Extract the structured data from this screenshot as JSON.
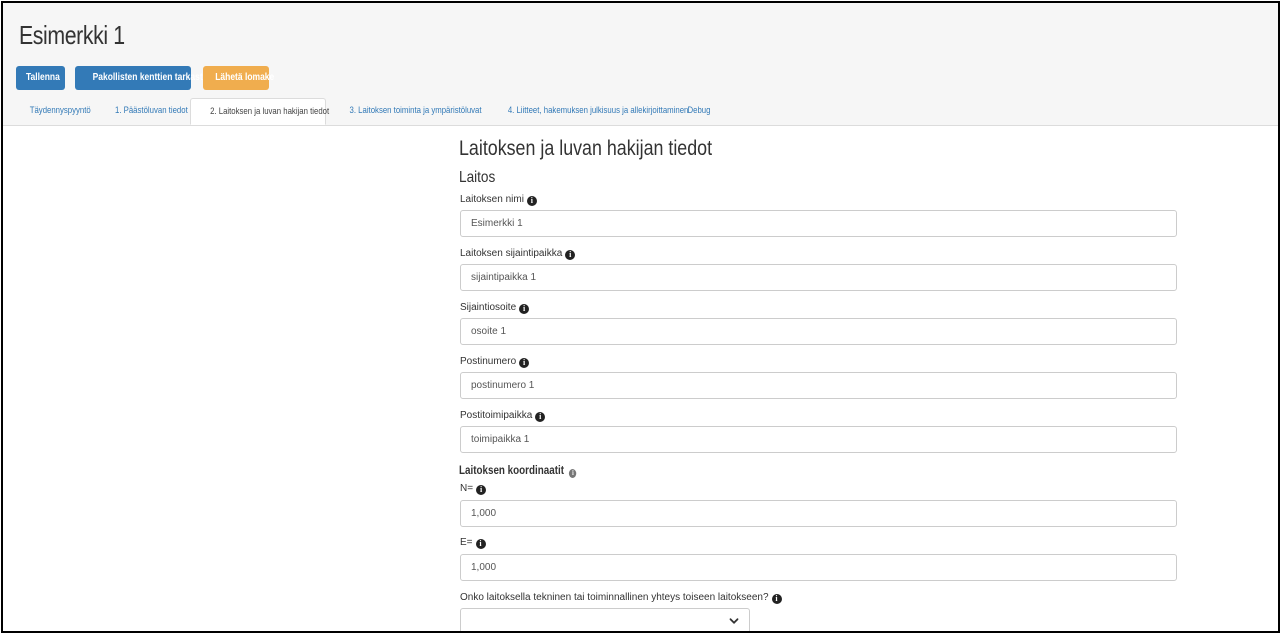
{
  "header": {
    "title": "Esimerkki 1",
    "buttons": {
      "save": "Tallenna",
      "check": "Pakollisten kenttien tarkastus",
      "send": "Lähetä lomake"
    },
    "tabs": [
      {
        "label": "Täydennyspyyntö",
        "active": false
      },
      {
        "label": "1. Päästöluvan tiedot",
        "active": false
      },
      {
        "label": "2. Laitoksen ja luvan hakijan tiedot",
        "active": true
      },
      {
        "label": "3. Laitoksen toiminta ja ympäristöluvat",
        "active": false
      },
      {
        "label": "4. Liitteet, hakemuksen julkisuus ja allekirjoittaminen",
        "active": false
      },
      {
        "label": "Debug",
        "active": false
      }
    ]
  },
  "main": {
    "section_title": "Laitoksen ja luvan hakijan tiedot",
    "subsection_title": "Laitos",
    "fields": {
      "name": {
        "label": "Laitoksen nimi",
        "value": "Esimerkki 1"
      },
      "location": {
        "label": "Laitoksen sijaintipaikka",
        "value": "sijaintipaikka 1"
      },
      "address": {
        "label": "Sijaintiosoite",
        "value": "osoite 1"
      },
      "postal_code": {
        "label": "Postinumero",
        "value": "postinumero 1"
      },
      "post_office": {
        "label": "Postitoimipaikka",
        "value": "toimipaikka 1"
      }
    },
    "coordinates": {
      "title": "Laitoksen koordinaatit",
      "n": {
        "label": "N=",
        "value": "1,000"
      },
      "e": {
        "label": "E=",
        "value": "1,000"
      }
    },
    "connection": {
      "label": "Onko laitoksella tekninen tai toiminnallinen yhteys toiseen laitokseen?",
      "selected": ""
    }
  },
  "colors": {
    "primary": "#337ab7",
    "warning": "#f0ad4e",
    "header_bg": "#f6f6f6"
  },
  "icons": {
    "info": "info-circle-icon",
    "dropdown": "chevron-down-icon"
  }
}
